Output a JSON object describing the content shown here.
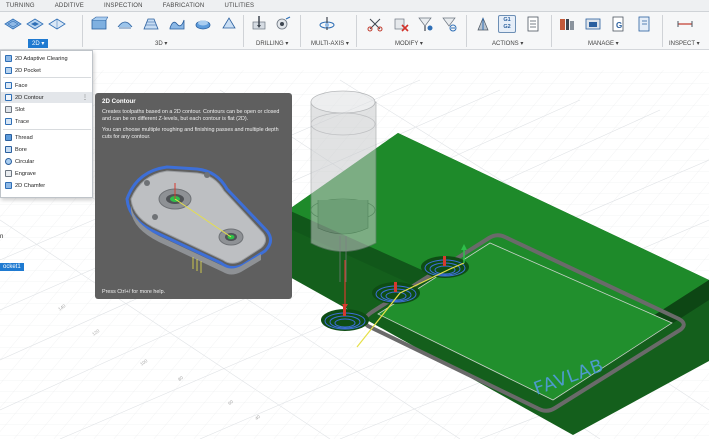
{
  "tabs": [
    "TURNING",
    "ADDITIVE",
    "INSPECTION",
    "FABRICATION",
    "UTILITIES"
  ],
  "ribbon": {
    "groups": {
      "g2d": "2D ▾",
      "g3d": "3D ▾",
      "drilling": "DRILLING ▾",
      "multiaxis": "MULTI-AXIS ▾",
      "modify": "MODIFY ▾",
      "actions": "ACTIONS ▾",
      "manage": "MANAGE ▾",
      "inspect": "INSPECT ▾"
    },
    "g1g2_line1": "G1",
    "g1g2_line2": "G2"
  },
  "menu": {
    "items": [
      "2D Adaptive Clearing",
      "2D Pocket",
      "Face",
      "2D Contour",
      "Slot",
      "Trace",
      "Thread",
      "Bore",
      "Circular",
      "Engrave",
      "2D Chamfer"
    ],
    "highlighted_index": 3,
    "kebab": "⋮"
  },
  "tooltip": {
    "title": "2D Contour",
    "p1": "Creates toolpaths based on a 2D contour. Contours can be open or closed and can be on different Z-levels, but each contour is flat (2D).",
    "p2": "You can choose multiple roughing and finishing passes and multiple depth cuts for any contour.",
    "footer": "Press Ctrl+/ for more help."
  },
  "browser": {
    "node_label": "ocket1",
    "side_fragment": "n"
  },
  "model": {
    "engraved_text": "FAVLAB",
    "plate_color": "#1e8a2a",
    "plate_dark": "#13641c",
    "toolpath_color": "#3d6fd8"
  },
  "grid_ticks": [
    "140",
    "120",
    "100",
    "80",
    "60",
    "40"
  ],
  "colors": {
    "accent": "#1f7ad1",
    "tooltip_bg": "#5f5f5f",
    "ribbon_bg": "#f6f7f8"
  }
}
